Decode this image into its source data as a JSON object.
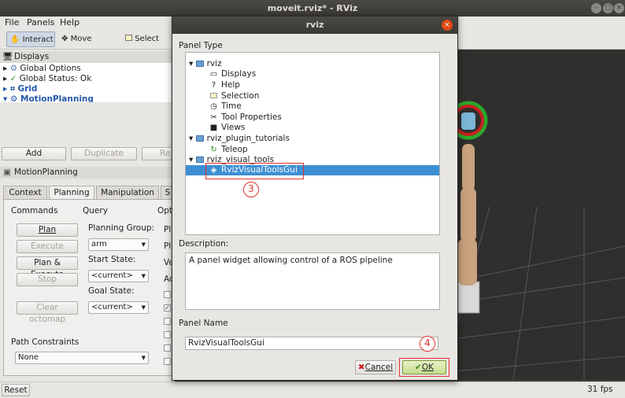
{
  "window": {
    "title": "moveit.rviz* - RViz"
  },
  "menubar": {
    "items": [
      "File",
      "Panels",
      "Help"
    ]
  },
  "toolbar": {
    "interact": "Interact",
    "move_camera": "Move Camera",
    "select": "Select"
  },
  "displays": {
    "header": "Displays",
    "items": [
      "Global Options",
      "Global Status: Ok",
      "Grid",
      "MotionPlanning"
    ],
    "add": "Add",
    "duplicate": "Duplicate",
    "rename": "Re"
  },
  "motion_planning": {
    "header": "MotionPlanning",
    "tabs": [
      "Context",
      "Planning",
      "Manipulation",
      "S"
    ],
    "commands_label": "Commands",
    "query_label": "Query",
    "options_label": "Opt",
    "buttons": {
      "plan": "Plan",
      "execute": "Execute",
      "plan_execute": "Plan & Execute",
      "stop": "Stop",
      "clear_octomap": "Clear octomap"
    },
    "planning_group_label": "Planning Group:",
    "planning_group_value": "arm",
    "start_state_label": "Start State:",
    "start_state_value": "<current>",
    "goal_state_label": "Goal State:",
    "goal_state_value": "<current>",
    "path_constraints_label": "Path Constraints",
    "path_constraints_value": "None",
    "option_fragments": [
      "Pl",
      "Pl",
      "Ve",
      "Ac"
    ]
  },
  "statusbar": {
    "reset": "Reset",
    "fps": "31 fps"
  },
  "dialog": {
    "title": "rviz",
    "panel_type_label": "Panel Type",
    "tree": [
      {
        "label": "rviz",
        "kind": "folder"
      },
      {
        "label": "Displays",
        "kind": "item",
        "icon": "monitor-icon"
      },
      {
        "label": "Help",
        "kind": "item",
        "icon": "question-icon"
      },
      {
        "label": "Selection",
        "kind": "item",
        "icon": "selection-icon"
      },
      {
        "label": "Time",
        "kind": "item",
        "icon": "clock-icon"
      },
      {
        "label": "Tool Properties",
        "kind": "item",
        "icon": "tools-icon"
      },
      {
        "label": "Views",
        "kind": "item",
        "icon": "camera-icon"
      },
      {
        "label": "rviz_plugin_tutorials",
        "kind": "folder"
      },
      {
        "label": "Teleop",
        "kind": "item",
        "icon": "refresh-icon"
      },
      {
        "label": "rviz_visual_tools",
        "kind": "folder"
      },
      {
        "label": "RvizVisualToolsGui",
        "kind": "item",
        "icon": "plugin-icon",
        "selected": true
      }
    ],
    "description_label": "Description:",
    "description": "A panel widget allowing control of a ROS pipeline",
    "panel_name_label": "Panel Name",
    "panel_name_value": "RvizVisualToolsGui",
    "cancel": "Cancel",
    "ok": "OK",
    "annotations": [
      "3",
      "4"
    ]
  },
  "colors": {
    "selection": "#3d8fd3",
    "annotation": "#e03030",
    "dialog_close": "#df4a16"
  }
}
